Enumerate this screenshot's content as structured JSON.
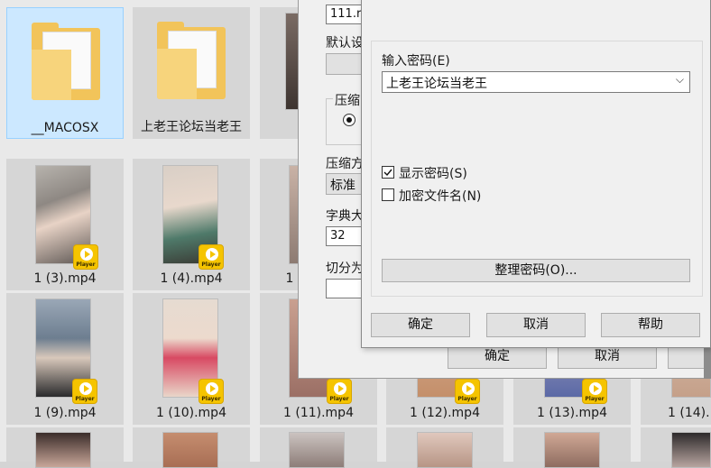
{
  "explorer": {
    "folders": [
      {
        "name": "__MACOSX"
      },
      {
        "name": "上老王论坛当老王"
      }
    ],
    "files_row1": [
      "1 (3).mp4",
      "1 (4).mp4",
      "1"
    ],
    "files_row2": [
      "1 (9).mp4",
      "1 (10).mp4",
      "1 (11).mp4",
      "1 (12).mp4",
      "1 (13).mp4",
      "1 (14)."
    ],
    "badge_text": "Player"
  },
  "archive_dialog": {
    "archive_name_value": "111.r",
    "default_label": "默认设",
    "compress_group_label": "压缩",
    "compress_method_label": "压缩方",
    "compress_method_value": "标准",
    "dict_size_label": "字典大",
    "dict_size_value": "32",
    "split_label": "切分为",
    "ok_label": "确定",
    "cancel_label": "取消",
    "help_label": "帮"
  },
  "password_dialog": {
    "password_label": "输入密码(E)",
    "password_value": "上老王论坛当老王",
    "show_password_label": "显示密码(S)",
    "show_password_checked": true,
    "encrypt_names_label": "加密文件名(N)",
    "encrypt_names_checked": false,
    "organize_label": "整理密码(O)...",
    "ok_label": "确定",
    "cancel_label": "取消",
    "help_label": "帮助"
  }
}
